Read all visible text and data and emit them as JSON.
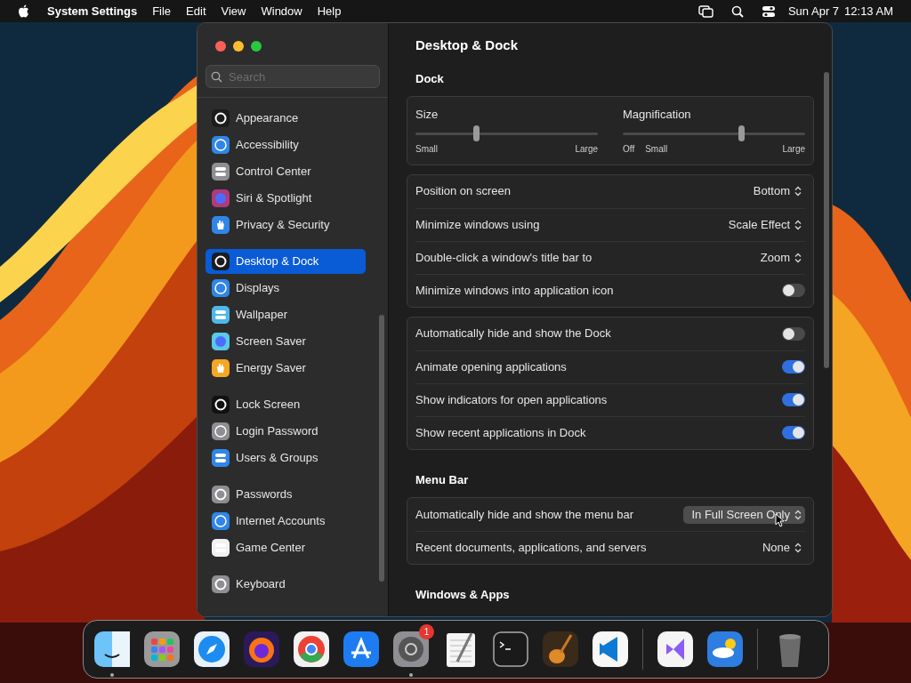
{
  "menu_bar": {
    "app_name": "System Settings",
    "menus": [
      "File",
      "Edit",
      "View",
      "Window",
      "Help"
    ],
    "date": "Sun Apr 7",
    "time": "12:13 AM"
  },
  "sidebar": {
    "search": {
      "placeholder": "Search"
    },
    "groups": [
      [
        {
          "label": "Appearance",
          "color": "#1c1c1e",
          "selected": false
        },
        {
          "label": "Accessibility",
          "color": "#2f86e8",
          "selected": false
        },
        {
          "label": "Control Center",
          "color": "#8e8e93",
          "selected": false
        },
        {
          "label": "Siri & Spotlight",
          "color": "#b03a7a",
          "selected": false
        },
        {
          "label": "Privacy & Security",
          "color": "#2f86e8",
          "selected": false
        }
      ],
      [
        {
          "label": "Desktop & Dock",
          "color": "#1c1c1e",
          "selected": true
        },
        {
          "label": "Displays",
          "color": "#2f86e8",
          "selected": false
        },
        {
          "label": "Wallpaper",
          "color": "#4fb8e8",
          "selected": false
        },
        {
          "label": "Screen Saver",
          "color": "#5ac8e6",
          "selected": false
        },
        {
          "label": "Energy Saver",
          "color": "#f5a623",
          "selected": false
        }
      ],
      [
        {
          "label": "Lock Screen",
          "color": "#111111",
          "selected": false
        },
        {
          "label": "Login Password",
          "color": "#8e8e93",
          "selected": false
        },
        {
          "label": "Users & Groups",
          "color": "#2f86e8",
          "selected": false
        }
      ],
      [
        {
          "label": "Passwords",
          "color": "#8e8e93",
          "selected": false
        },
        {
          "label": "Internet Accounts",
          "color": "#2f86e8",
          "selected": false
        },
        {
          "label": "Game Center",
          "color": "#f2f2f2",
          "selected": false
        }
      ],
      [
        {
          "label": "Keyboard",
          "color": "#8e8e93",
          "selected": false
        }
      ]
    ]
  },
  "content": {
    "title": "Desktop & Dock",
    "sections": [
      {
        "heading": "Dock",
        "cards": [
          {
            "kind": "sliders",
            "sliders": [
              {
                "label": "Size",
                "level": 0.33,
                "ticks": [
                  "Small",
                  "Large"
                ]
              },
              {
                "label": "Magnification",
                "level": 0.65,
                "ticks": [
                  "Off",
                  "Small",
                  "Large"
                ]
              }
            ]
          },
          {
            "kind": "rows",
            "rows": [
              {
                "kind": "popup",
                "label": "Position on screen",
                "value": "Bottom",
                "highlighted": false
              },
              {
                "kind": "popup",
                "label": "Minimize windows using",
                "value": "Scale Effect",
                "highlighted": false
              },
              {
                "kind": "popup",
                "label": "Double-click a window's title bar to",
                "value": "Zoom",
                "highlighted": false
              },
              {
                "kind": "toggle",
                "label": "Minimize windows into application icon",
                "on": false
              }
            ]
          },
          {
            "kind": "rows",
            "rows": [
              {
                "kind": "toggle",
                "label": "Automatically hide and show the Dock",
                "on": false
              },
              {
                "kind": "toggle",
                "label": "Animate opening applications",
                "on": true
              },
              {
                "kind": "toggle",
                "label": "Show indicators for open applications",
                "on": true
              },
              {
                "kind": "toggle",
                "label": "Show recent applications in Dock",
                "on": true
              }
            ]
          }
        ]
      },
      {
        "heading": "Menu Bar",
        "cards": [
          {
            "kind": "rows",
            "rows": [
              {
                "kind": "popup",
                "label": "Automatically hide and show the menu bar",
                "value": "In Full Screen Only",
                "highlighted": true
              },
              {
                "kind": "popup",
                "label": "Recent documents, applications, and servers",
                "value": "None",
                "highlighted": false
              }
            ]
          }
        ]
      },
      {
        "heading": "Windows & Apps"
      }
    ]
  },
  "dock": [
    {
      "kind": "app",
      "running": true
    },
    {
      "kind": "app",
      "running": false
    },
    {
      "kind": "app",
      "running": false
    },
    {
      "kind": "app",
      "running": false
    },
    {
      "kind": "app",
      "running": false
    },
    {
      "kind": "app",
      "running": false
    },
    {
      "kind": "app",
      "running": true,
      "badge": "1"
    },
    {
      "kind": "app",
      "running": false
    },
    {
      "kind": "app",
      "running": false
    },
    {
      "kind": "app",
      "running": false
    },
    {
      "kind": "app",
      "running": false
    },
    {
      "kind": "separator"
    },
    {
      "kind": "app",
      "running": false
    },
    {
      "kind": "app",
      "running": false
    },
    {
      "kind": "separator"
    },
    {
      "kind": "app",
      "running": false
    }
  ]
}
